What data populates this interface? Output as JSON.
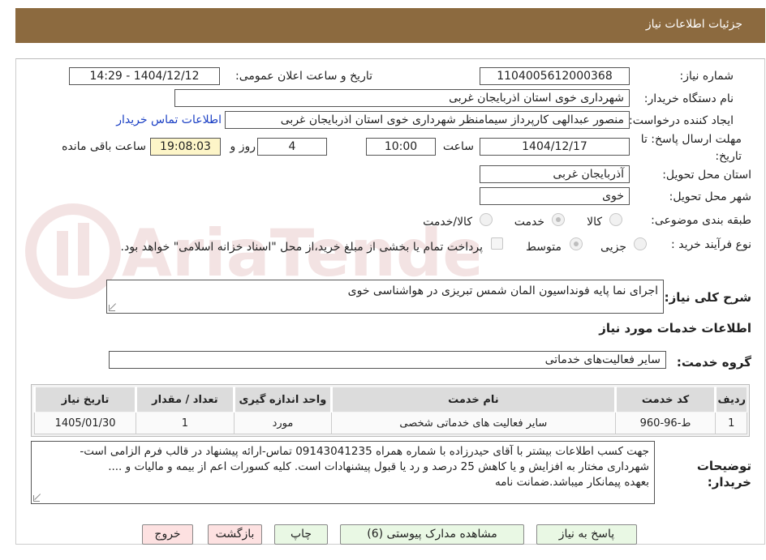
{
  "header": {
    "title": "جزئیات اطلاعات نیاز"
  },
  "fields": {
    "need_number_label": "شماره نیاز:",
    "need_number": "1104005612000368",
    "announce_label": "تاریخ و ساعت اعلان عمومی:",
    "announce_value": "1404/12/12 - 14:29",
    "buyer_org_label": "نام دستگاه خریدار:",
    "buyer_org": "شهرداری خوی استان اذربایجان غربی",
    "requester_label": "ایجاد کننده درخواست:",
    "requester": "منصور عبدالهی کارپرداز سیمامنظر شهرداری خوی استان اذربایجان غربی",
    "contact_link": "اطلاعات تماس خریدار",
    "deadline_label_1": "مهلت ارسال پاسخ: تا",
    "deadline_label_2": "تاریخ:",
    "deadline_date": "1404/12/17",
    "time_label": "ساعت",
    "deadline_time": "10:00",
    "days_value": "4",
    "days_label": "روز و",
    "remaining_time": "19:08:03",
    "remaining_label": "ساعت باقی مانده",
    "province_label": "استان محل تحویل:",
    "province": "آذربایجان غربی",
    "city_label": "شهر محل تحویل:",
    "city": "خوی",
    "category_label": "طبقه بندی موضوعی:",
    "category_options": [
      "کالا",
      "خدمت",
      "کالا/خدمت"
    ],
    "process_label": "نوع فرآیند خرید :",
    "process_options": [
      "جزیی",
      "متوسط"
    ],
    "payment_note": "پرداخت تمام یا بخشی از مبلغ خرید،از محل \"اسناد خزانه اسلامی\" خواهد بود."
  },
  "description": {
    "label": "شرح کلی نیاز:",
    "text": "اجرای نما پایه فونداسیون المان شمس تبریزی در هواشناسی خوی"
  },
  "services": {
    "section_title": "اطلاعات خدمات مورد نیاز",
    "group_label": "گروه خدمت:",
    "group_value": "سایر فعالیت‌های خدماتی",
    "columns": [
      "ردیف",
      "کد خدمت",
      "نام خدمت",
      "واحد اندازه گیری",
      "تعداد / مقدار",
      "تاریخ نیاز"
    ],
    "rows": [
      [
        "1",
        "ط-96-960",
        "سایر فعالیت های خدماتی شخصی",
        "مورد",
        "1",
        "1405/01/30"
      ]
    ]
  },
  "buyer_notes": {
    "label_1": "توضیحات",
    "label_2": "خریدار:",
    "line_1": "جهت کسب اطلاعات بیشتر با آقای حیدرزاده با شماره همراه 09143041235 تماس-ارائه پیشنهاد در قالب فرم الزامی است-",
    "line_2": "شهرداری مختار به افزایش و یا کاهش 25 درصد و رد یا قبول پیشنهادات است. کلیه کسورات اعم از بیمه و مالیات و ....",
    "line_3": "بعهده پیمانکار میباشد.ضمانت نامه"
  },
  "buttons": {
    "reply": "پاسخ به نیاز",
    "attachments": "مشاهده مدارک پیوستی (6)",
    "print": "چاپ",
    "back": "بازگشت",
    "exit": "خروج"
  },
  "watermark": {
    "text": "AriaTender.neT"
  },
  "colors": {
    "header": "#8c6a3f",
    "link": "#1a3fc4",
    "button_green": "#e9f8e4",
    "button_pink": "#fde1e1"
  }
}
